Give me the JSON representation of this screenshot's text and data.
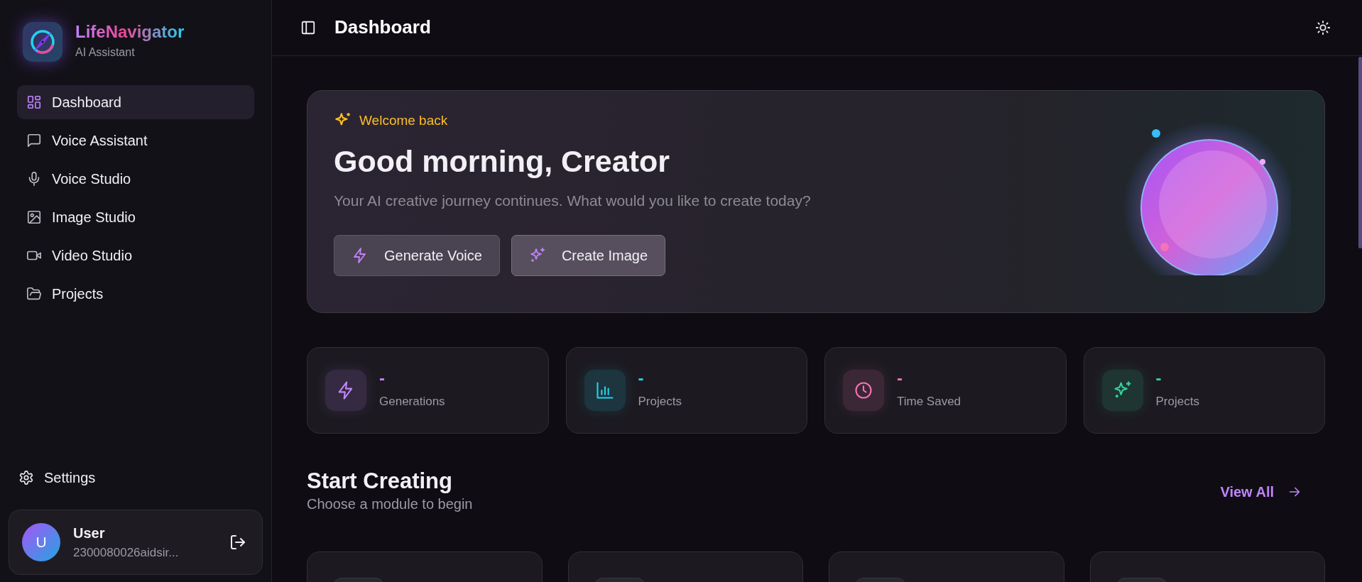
{
  "sidebar": {
    "brand": {
      "name": "LifeNavigator",
      "subtitle": "AI Assistant"
    },
    "items": [
      {
        "label": "Dashboard",
        "selected": true
      },
      {
        "label": "Voice Assistant",
        "selected": false
      },
      {
        "label": "Voice Studio",
        "selected": false
      },
      {
        "label": "Image Studio",
        "selected": false
      },
      {
        "label": "Video Studio",
        "selected": false
      },
      {
        "label": "Projects",
        "selected": false
      }
    ],
    "settings": {
      "label": "Settings"
    },
    "user": {
      "initial": "U",
      "name": "User",
      "email": "2300080026aidsir..."
    }
  },
  "header": {
    "title": "Dashboard"
  },
  "hero": {
    "eyebrow": "Welcome back",
    "title": "Good morning, Creator",
    "subtitle": "Your AI creative journey continues. What would you like to create today?",
    "buttons": [
      {
        "label": "Generate Voice"
      },
      {
        "label": "Create Image"
      }
    ]
  },
  "stats": [
    {
      "value": "-",
      "label": "Generations",
      "color": "#c084fc"
    },
    {
      "value": "-",
      "label": "Projects",
      "color": "#22d3ee"
    },
    {
      "value": "-",
      "label": "Time Saved",
      "color": "#f472b6"
    },
    {
      "value": "-",
      "label": "Projects",
      "color": "#34d399"
    }
  ],
  "section": {
    "title": "Start Creating",
    "subtitle": "Choose a module to begin",
    "link": "View All"
  }
}
